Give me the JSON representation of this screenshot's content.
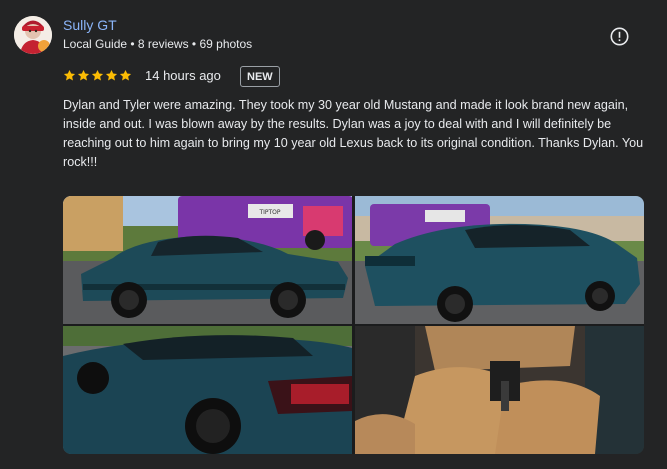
{
  "reviewer": {
    "name": "Sully GT",
    "meta": "Local Guide • 8 reviews • 69 photos"
  },
  "review": {
    "rating": 5,
    "max_rating": 5,
    "time": "14 hours ago",
    "badge": "NEW",
    "text": "Dylan and Tyler were amazing. They took my 30 year old Mustang and made it look brand new again, inside and out. I was blown away by the results. Dylan was a joy to deal with and I will definitely be reaching out to him again to bring my 10 year old Lexus back to its original condition. Thanks Dylan. You rock!!!"
  },
  "colors": {
    "star": "#fbbc04",
    "name_link": "#8ab4f8",
    "background": "#232425",
    "car_body": "#1d4a58"
  },
  "icons": {
    "more": "info-circle-icon",
    "star": "star-icon"
  },
  "photos": {
    "count": 4,
    "van_sign_text": "TIPTOP"
  }
}
